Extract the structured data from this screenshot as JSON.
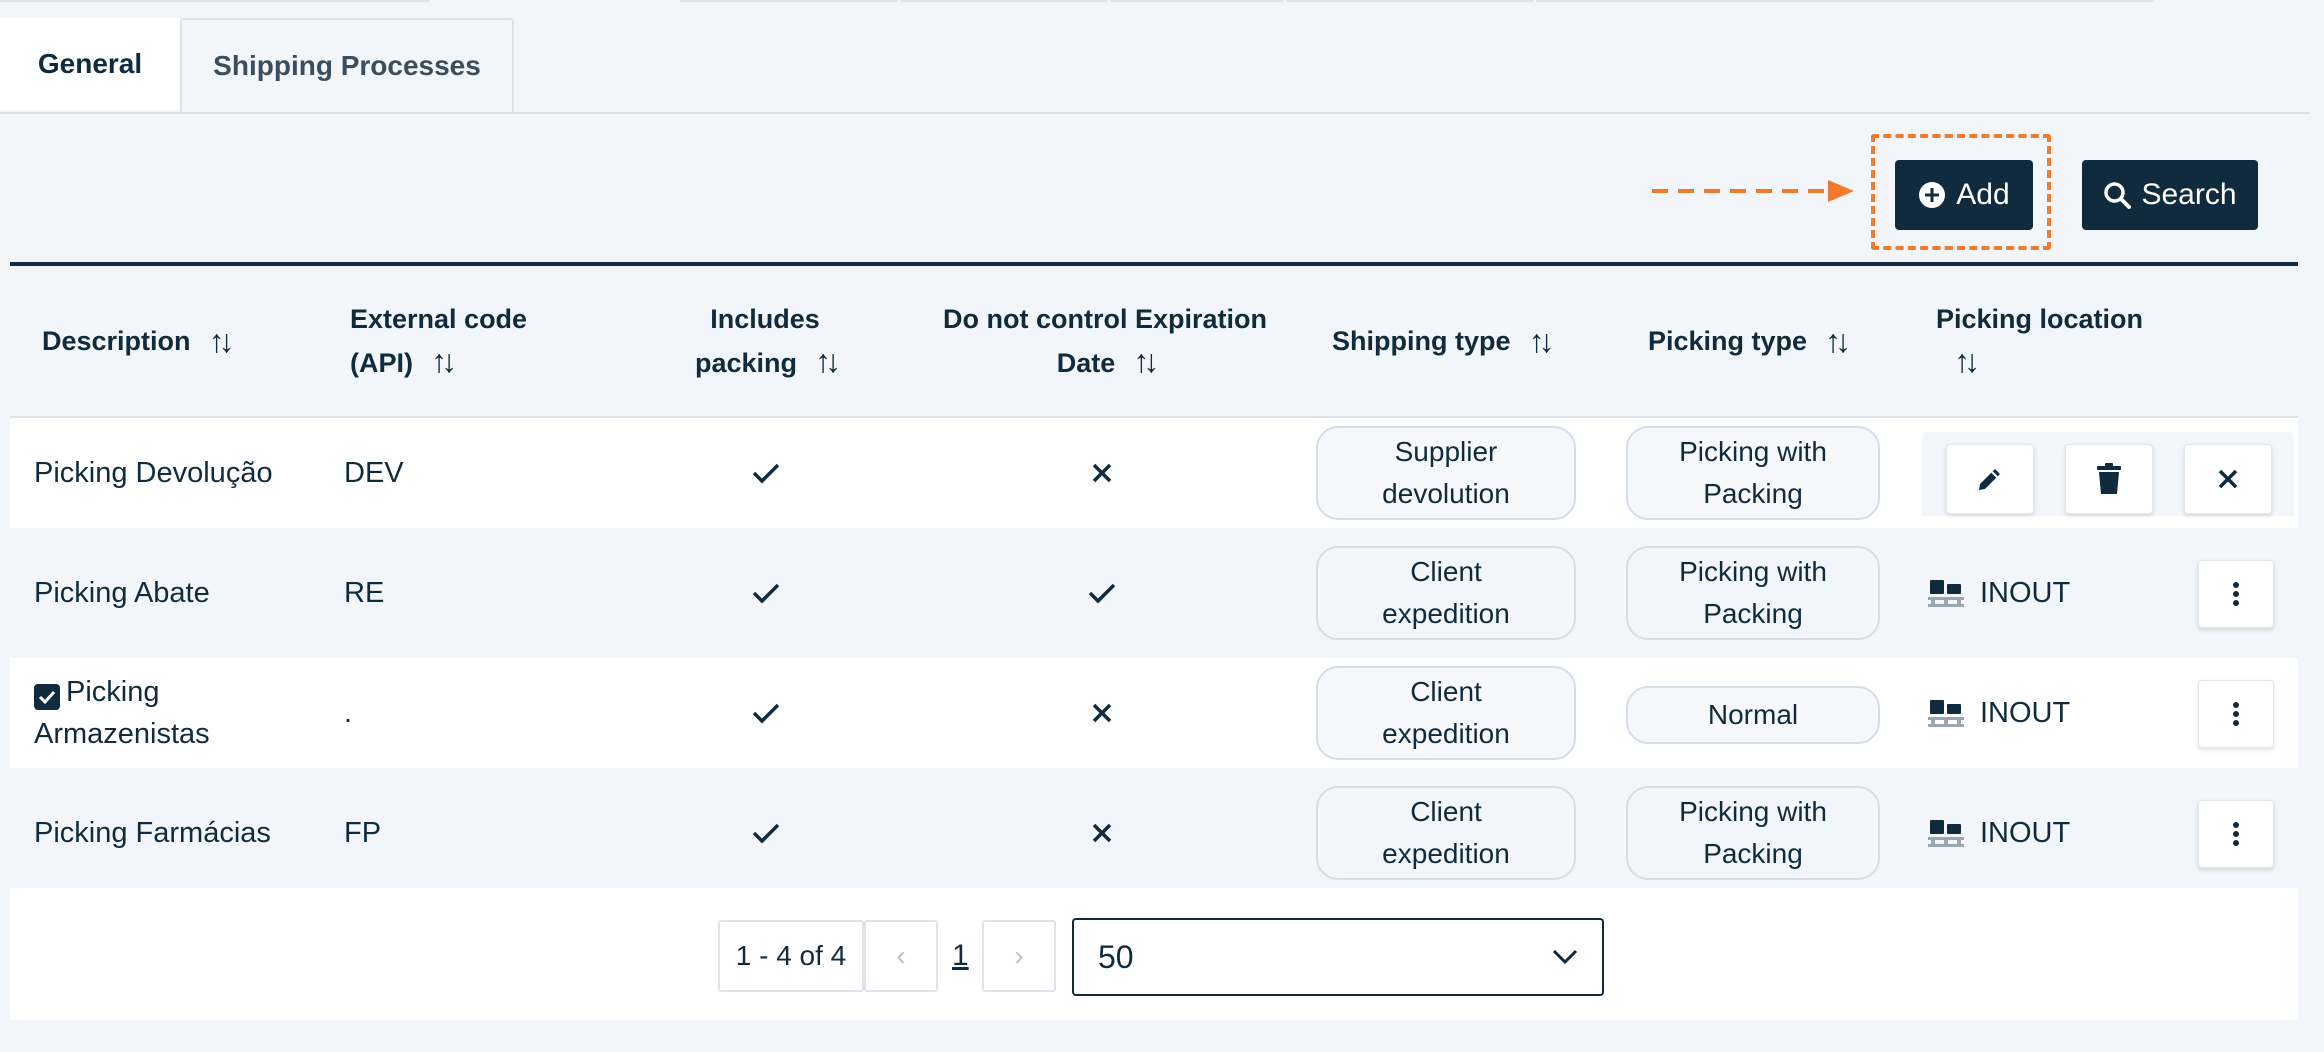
{
  "tabs": [
    {
      "label": "General",
      "active": true
    },
    {
      "label": "Shipping Processes",
      "active": false
    }
  ],
  "toolbar": {
    "add_label": "Add",
    "search_label": "Search",
    "highlight_color": "#f07a2e"
  },
  "table": {
    "headers": {
      "description": "Description",
      "external_code_1": "External code",
      "external_code_2": "(API)",
      "includes_packing_1": "Includes",
      "includes_packing_2": "packing",
      "no_expiration_1": "Do not control Expiration",
      "no_expiration_2": "Date",
      "shipping_type": "Shipping type",
      "picking_type": "Picking type",
      "picking_location": "Picking location",
      "sort_icon": "sort-icon"
    },
    "rows": [
      {
        "description": "Picking Devolução",
        "external_code": "DEV",
        "includes_packing": "check",
        "no_expiration": "cross",
        "shipping_type_1": "Supplier",
        "shipping_type_2": "devolution",
        "picking_type_1": "Picking with",
        "picking_type_2": "Packing",
        "picking_location": "",
        "editing": true
      },
      {
        "description": "Picking Abate",
        "external_code": "RE",
        "includes_packing": "check",
        "no_expiration": "check",
        "shipping_type_1": "Client",
        "shipping_type_2": "expedition",
        "picking_type_1": "Picking with",
        "picking_type_2": "Packing",
        "picking_location": "INOUT"
      },
      {
        "description_1": "Picking",
        "description_2": "Armazenistas",
        "selected": true,
        "external_code": ".",
        "includes_packing": "check",
        "no_expiration": "cross",
        "shipping_type_1": "Client",
        "shipping_type_2": "expedition",
        "picking_type": "Normal",
        "picking_location": "INOUT"
      },
      {
        "description": "Picking Farmácias",
        "external_code": "FP",
        "includes_packing": "check",
        "no_expiration": "cross",
        "shipping_type_1": "Client",
        "shipping_type_2": "expedition",
        "picking_type_1": "Picking with",
        "picking_type_2": "Packing",
        "picking_location": "INOUT"
      }
    ]
  },
  "pagination": {
    "range": "1 - 4 of 4",
    "prev": "‹",
    "current_page": "1",
    "next": "›",
    "page_size": "50"
  },
  "colors": {
    "primary": "#0f2b3d",
    "background": "#f2f5f9",
    "accent_dashed": "#f07a2e"
  }
}
